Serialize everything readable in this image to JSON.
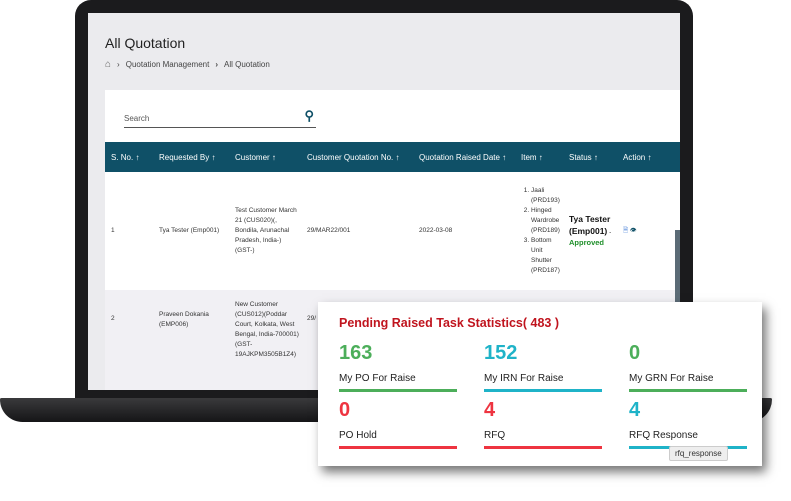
{
  "page": {
    "title": "All Quotation"
  },
  "breadcrumb": [
    "Quotation Management",
    "All Quotation"
  ],
  "search": {
    "placeholder": "Search"
  },
  "table": {
    "headers": [
      "S. No.",
      "Requested By",
      "Customer",
      "Customer Quotation No.",
      "Quotation Raised Date",
      "Item",
      "Status",
      "Action"
    ],
    "rows": [
      {
        "sno": "1",
        "requested_by": "Tya Tester (Emp001)",
        "customer": "Test Customer March 21 (CUS020)(, Bondila, Arunachal Pradesh, India-) (GST-)",
        "quotation_no": "29/MAR22/001",
        "date": "2022-03-08",
        "items": [
          "Jaali (PRD193)",
          "Hinged Wardrobe (PRD189)",
          "Bottom Unit Shutter (PRD187)"
        ],
        "status_person": "Tya Tester (Emp001)",
        "status": "Approved"
      },
      {
        "sno": "2",
        "requested_by": "Praveen Dokania (EMP006)",
        "customer": "New Customer (CUS012)(Poddar Court, Kolkata, West Bengal, India-700001)(GST-19AJKPM3505B1Z4)",
        "quotation_no": "29/"
      }
    ]
  },
  "stats": {
    "title": "Pending Raised Task Statistics( 483 )",
    "items": [
      {
        "value": "163",
        "label": "My PO For Raise",
        "color": "#4cae5a"
      },
      {
        "value": "152",
        "label": "My IRN For Raise",
        "color": "#1fb3c8"
      },
      {
        "value": "0",
        "label": "My GRN For Raise",
        "color": "#4cae5a"
      },
      {
        "value": "0",
        "label": "PO Hold",
        "color": "#ee3440"
      },
      {
        "value": "4",
        "label": "RFQ",
        "color": "#ee3440"
      },
      {
        "value": "4",
        "label": "RFQ Response",
        "color": "#1fb3c8"
      }
    ],
    "tooltip": "rfq_response"
  }
}
